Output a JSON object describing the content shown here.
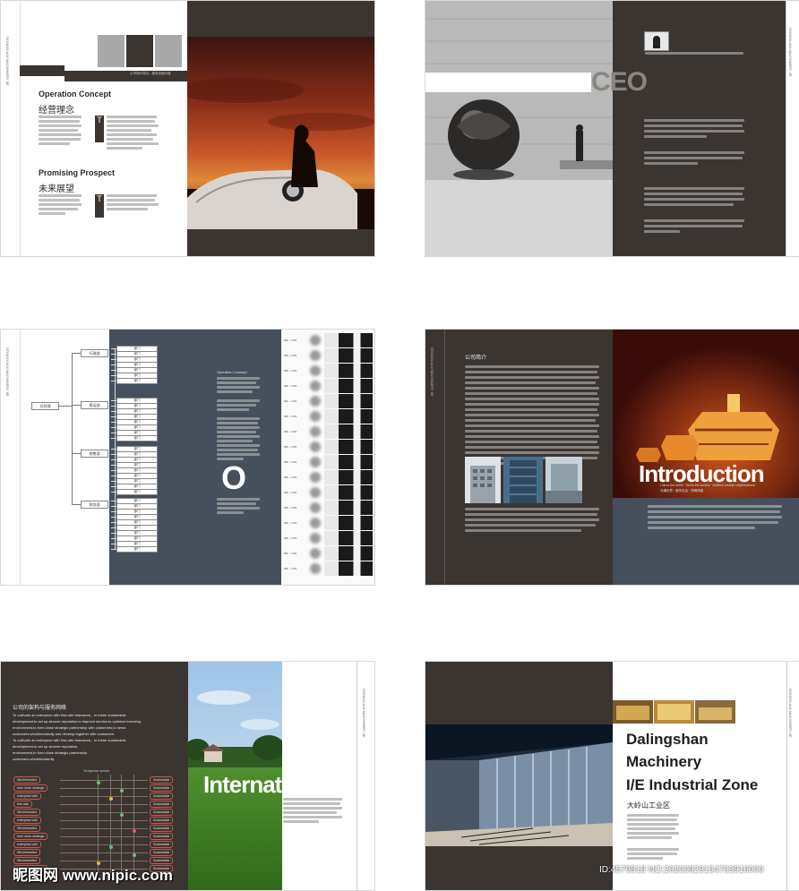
{
  "spread1": {
    "h_operation": "Operation Concept",
    "h_operation_cn": "经营理念",
    "h_promising": "Promising Prospect",
    "h_promising_cn": "未来展望",
    "cap_small": "以市场为导向，服务创造价值"
  },
  "spread2": {
    "big_word": "CEO"
  },
  "spread3": {
    "big_letter": "O",
    "op_title": "Operation Concept",
    "org_root": "总经理",
    "org_depts": [
      "行政部",
      "营运部",
      "销售部",
      "财务部"
    ],
    "org_leaf": "部门",
    "person_tag": "BRI - UON"
  },
  "spread4": {
    "intro_title_cn": "公司简介",
    "big_word": "Introduction",
    "tagline": "Link to the world · Serve the society · Achieve another resplendence",
    "tagline_cn": "沟通世界 · 服务社会 · 再铸辉煌"
  },
  "spread5": {
    "section_cn": "公司的架构与服务网络",
    "lead_lines": [
      "To cultivate an enterprise with first-rate teamwork，to foster sustainable",
      "development,to set up sincere reputation,to improve service,to optimize investing",
      "environment,to form close strategic partnership with customers,to serve",
      "customers wholeheartedly and develop together with customers.",
      "To cultivate an enterprise with first-rate teamwork，to foster sustainable",
      "development,to set up sincere reputation,",
      "environment,to form close strategic partnership",
      "customers wholeheartedly"
    ],
    "chart_header": "To improve service",
    "net_left": [
      "Wholehearted",
      "form close strategic",
      "enterprise with",
      "first-rate",
      "Wholehearted",
      "enterprise with",
      "Wholehearted",
      "form close strategic",
      "enterprise with",
      "Wholehearted",
      "Wholehearted",
      "form close strategic"
    ],
    "net_right": [
      "Sustainable",
      "Sustainable",
      "Sustainable",
      "Sustainable",
      "Sustainable",
      "Sustainable",
      "Sustainable",
      "Sustainable",
      "Sustainable",
      "Sustainable",
      "Sustainable",
      "Sustainable"
    ],
    "big_word": "Internation"
  },
  "spread6": {
    "title_line1": "Dalingshan",
    "title_line2": "Machinery",
    "title_line3": "I/E Industrial Zone",
    "title_cn": "大岭山工业区"
  },
  "watermark": {
    "site": "昵图网 www.nipic.com",
    "id_line": "ID:4579818 NO:20200929154703916000"
  },
  "colors": {
    "dark": "#3b3532",
    "slate": "#45505c"
  }
}
